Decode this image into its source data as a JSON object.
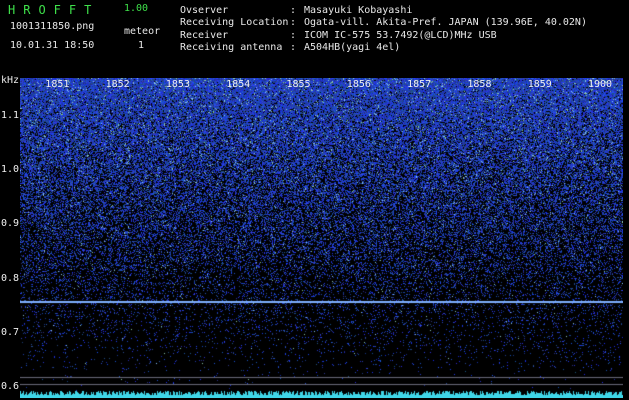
{
  "app": {
    "title": "HROFFT",
    "version": "1.00"
  },
  "capture": {
    "filename": "1001311850.png",
    "datetime": "10.01.31 18:50",
    "meteor_label": "meteor",
    "meteor_count": "1"
  },
  "info": [
    {
      "key": "Ovserver",
      "value": "Masayuki Kobayashi"
    },
    {
      "key": "Receiving Location",
      "value": "Ogata-vill. Akita-Pref. JAPAN (139.96E, 40.02N)"
    },
    {
      "key": "Receiver",
      "value": "ICOM IC-575 53.7492(@LCD)MHz USB"
    },
    {
      "key": "Receiving antenna",
      "value": "A504HB(yagi 4el)"
    }
  ],
  "chart_data": {
    "type": "heatmap",
    "ylabel": "kHz",
    "y_ticks": [
      "1.1",
      "1.0",
      "0.9",
      "0.8",
      "0.7",
      "0.6"
    ],
    "x_ticks": [
      "1851",
      "1852",
      "1853",
      "1854",
      "1855",
      "1856",
      "1857",
      "1858",
      "1859",
      "1900"
    ],
    "ylim": [
      0.58,
      1.17
    ],
    "xlim": [
      "18:50",
      "19:00"
    ],
    "signal_lines_khz": [
      0.758
    ],
    "colors": {
      "background": "#000000",
      "noise": "#1e3cff",
      "signal": "#7fb0ff",
      "baseline": "#3fd6e8",
      "tick_text": "#f0f0f0"
    }
  }
}
